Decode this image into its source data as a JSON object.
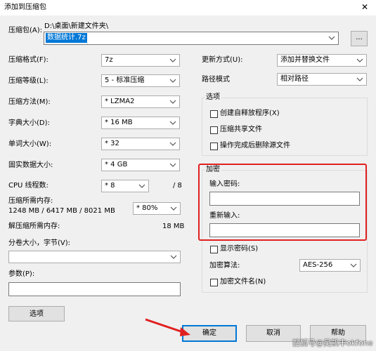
{
  "window": {
    "title": "添加到压缩包",
    "close_glyph": "✕"
  },
  "archive": {
    "label": "压缩包(A):",
    "path": "D:\\桌面\\新建文件夹\\",
    "filename": "数据统计.7z",
    "browse_label": "..."
  },
  "left": {
    "format": {
      "label": "压缩格式(F):",
      "value": "7z"
    },
    "level": {
      "label": "压缩等级(L):",
      "value": "5 - 标准压缩"
    },
    "method": {
      "label": "压缩方法(M):",
      "value": "* LZMA2"
    },
    "dict": {
      "label": "字典大小(D):",
      "value": "* 16 MB"
    },
    "word": {
      "label": "单词大小(W):",
      "value": "* 32"
    },
    "solid": {
      "label": "固实数据大小:",
      "value": "* 4 GB"
    },
    "cpu": {
      "label": "CPU 线程数:",
      "value": "* 8",
      "max": "/ 8"
    },
    "memory": {
      "label": "压缩所需内存:",
      "detail": "1248 MB / 6417 MB / 8021 MB",
      "value": "* 80%"
    },
    "decomp": {
      "label": "解压缩所需内存:",
      "value": "18 MB"
    },
    "split": {
      "label": "分卷大小，字节(V):",
      "value": ""
    },
    "params": {
      "label": "参数(P):",
      "value": ""
    },
    "options_button": "选项"
  },
  "right": {
    "update": {
      "label": "更新方式(U):",
      "value": "添加并替换文件"
    },
    "pathmode": {
      "label": "路径模式",
      "value": "相对路径"
    },
    "options": {
      "title": "选项",
      "items": [
        "创建自释放程序(X)",
        "压缩共享文件",
        "操作完成后删除源文件"
      ]
    },
    "encryption": {
      "title": "加密",
      "password_label": "输入密码:",
      "reenter_label": "重新输入:",
      "show_password": "显示密码(S)",
      "method_label": "加密算法:",
      "method_value": "AES-256",
      "encrypt_names": "加密文件名(N)"
    }
  },
  "buttons": {
    "ok": "确定",
    "cancel": "取消",
    "help": "帮助"
  },
  "watermark": "搜狐号@吴凯丰okfone",
  "colors": {
    "highlight": "#e02020",
    "selection": "#0078d7",
    "ok_border": "#0078d7"
  }
}
